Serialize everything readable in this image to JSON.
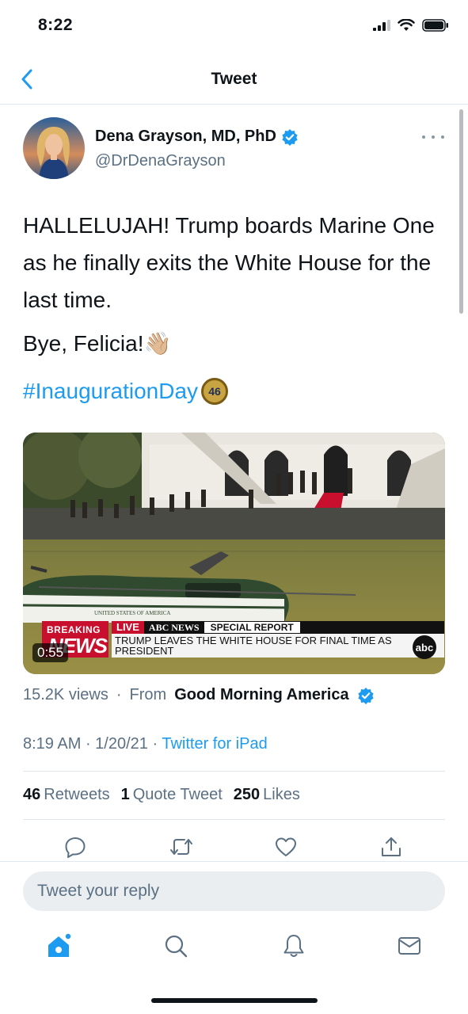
{
  "status_bar": {
    "time": "8:22"
  },
  "nav": {
    "title": "Tweet"
  },
  "author": {
    "name": "Dena Grayson, MD, PhD",
    "handle": "@DrDenaGrayson",
    "verified": true
  },
  "tweet": {
    "text": "HALLELUJAH! Trump boards Marine One as he finally exits the White House for the last time.",
    "line2": "Bye, Felicia!",
    "line2_emoji": "👋🏼",
    "hashtag": "#InaugurationDay",
    "hashtag_badge": "46"
  },
  "media": {
    "duration": "0:55",
    "breaking_top": "BREAKING",
    "breaking_main": "NEWS",
    "live": "LIVE",
    "network": "ABC NEWS",
    "special": "SPECIAL REPORT",
    "headline": "TRUMP LEAVES THE WHITE HOUSE FOR FINAL TIME AS PRESIDENT",
    "logo": "abc",
    "helicopter_text": "UNITED STATES OF AMERICA"
  },
  "views": {
    "count": "15.2K views",
    "from_label": "From",
    "source": "Good Morning America"
  },
  "meta": {
    "time": "8:19 AM",
    "date": "1/20/21",
    "client": "Twitter for iPad"
  },
  "stats": {
    "retweets_count": "46",
    "retweets_label": "Retweets",
    "quotes_count": "1",
    "quotes_label": "Quote Tweet",
    "likes_count": "250",
    "likes_label": "Likes"
  },
  "reply": {
    "placeholder": "Tweet your reply"
  },
  "colors": {
    "accent": "#1d9bf0",
    "text": "#0f1419",
    "muted": "#5b7083",
    "border": "#e1e8ed"
  },
  "icons": [
    "back-chevron-icon",
    "verified-icon",
    "more-icon",
    "reply-icon",
    "retweet-icon",
    "like-icon",
    "share-icon",
    "home-icon",
    "search-icon",
    "notifications-icon",
    "messages-icon"
  ]
}
